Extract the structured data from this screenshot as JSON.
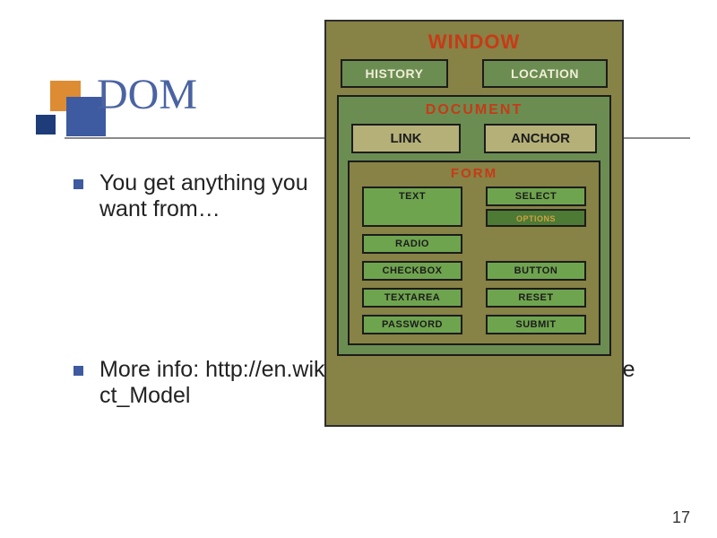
{
  "slide": {
    "title": "DOM",
    "page_number": "17",
    "bullets": [
      "You get anything you want from…",
      "More info: http://en.wikipedia.org/wiki/Document_Object_Model"
    ]
  },
  "diagram": {
    "window": {
      "title": "WINDOW",
      "history": "HISTORY",
      "location": "LOCATION"
    },
    "document": {
      "title": "DOCUMENT",
      "link": "LINK",
      "anchor": "ANCHOR"
    },
    "form": {
      "title": "FORM",
      "left": [
        "TEXT",
        "RADIO",
        "CHECKBOX",
        "TEXTAREA",
        "PASSWORD"
      ],
      "right_stack": {
        "select": "SELECT",
        "options": "OPTIONS"
      },
      "right_rest": [
        "BUTTON",
        "RESET",
        "SUBMIT"
      ]
    }
  }
}
